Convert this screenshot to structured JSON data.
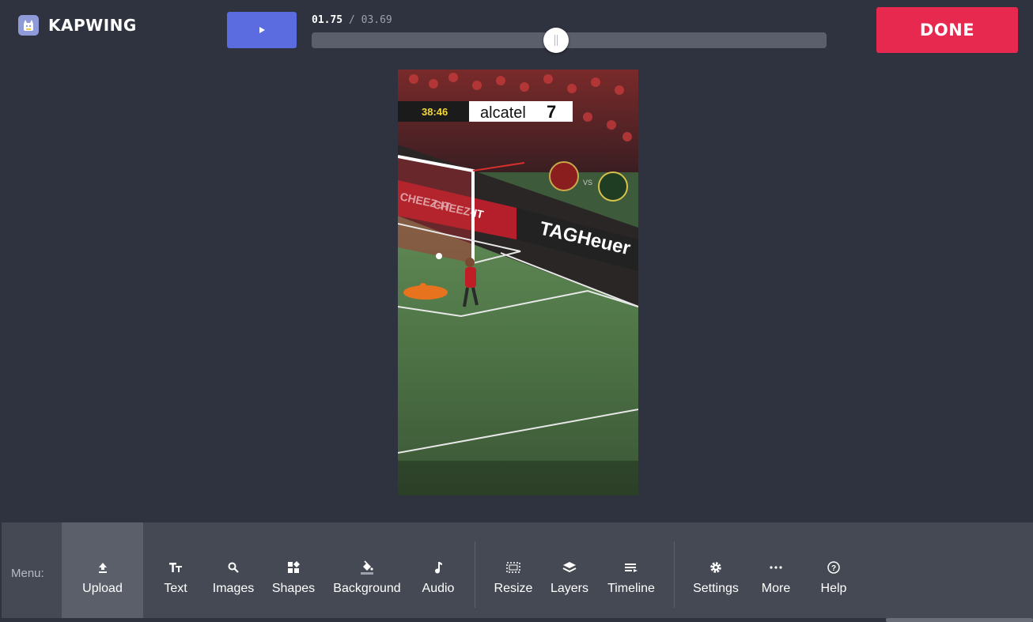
{
  "app": {
    "name": "KAPWING",
    "done_label": "DONE"
  },
  "playback": {
    "current_time": "01.75",
    "separator": "/",
    "total_time": "03.69",
    "progress": 0.474,
    "play_icon": "play-icon"
  },
  "video_overlay": {
    "clock": "38:46",
    "sponsor": "alcatel",
    "sponsor_number": "7",
    "board_1": "TAGHeuer",
    "board_2": "CHEEZ-IT",
    "board_3": "CHEEZ-IT",
    "vs": "VS"
  },
  "toolbar": {
    "menu_label": "Menu:",
    "items": [
      {
        "label": "Upload",
        "icon": "upload-icon"
      },
      {
        "label": "Text",
        "icon": "text-icon"
      },
      {
        "label": "Images",
        "icon": "search-icon"
      },
      {
        "label": "Shapes",
        "icon": "shapes-icon"
      },
      {
        "label": "Background",
        "icon": "paint-bucket-icon"
      },
      {
        "label": "Audio",
        "icon": "music-note-icon"
      },
      {
        "label": "Resize",
        "icon": "resize-icon"
      },
      {
        "label": "Layers",
        "icon": "layers-icon"
      },
      {
        "label": "Timeline",
        "icon": "timeline-icon"
      },
      {
        "label": "Settings",
        "icon": "gear-icon"
      },
      {
        "label": "More",
        "icon": "more-icon"
      },
      {
        "label": "Help",
        "icon": "help-icon"
      }
    ]
  },
  "colors": {
    "background": "#2f333f",
    "toolbar": "#454954",
    "play_button": "#5b6ce0",
    "done_button": "#e8294f",
    "active_tool": "#5b5f6a"
  }
}
